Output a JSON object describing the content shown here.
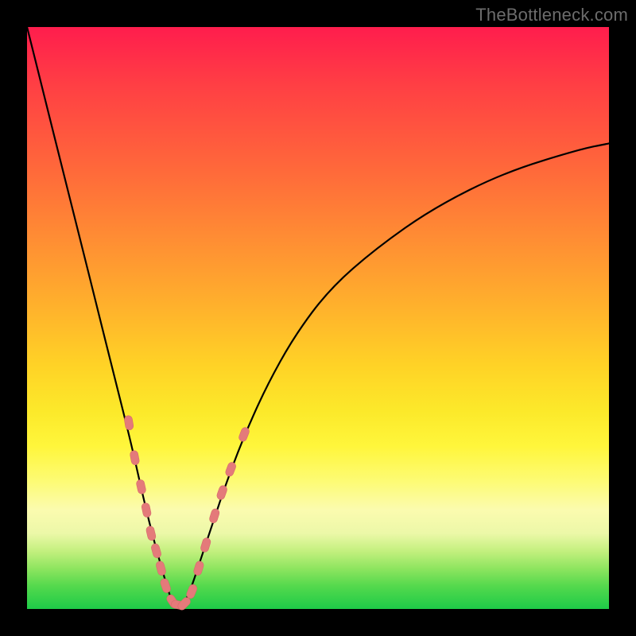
{
  "watermark": "TheBottleneck.com",
  "colors": {
    "frame": "#000000",
    "curve": "#000000",
    "marker": "#e47a7a",
    "gradient_stops": [
      "#ff1d4d",
      "#ff6a3a",
      "#ffb12c",
      "#fff63b",
      "#1ecb48"
    ]
  },
  "chart_data": {
    "type": "line",
    "title": "",
    "xlabel": "",
    "ylabel": "",
    "xlim": [
      0,
      100
    ],
    "ylim": [
      0,
      100
    ],
    "grid": false,
    "legend": false,
    "series": [
      {
        "name": "bottleneck-curve",
        "x": [
          0,
          3,
          6,
          9,
          12,
          15,
          18,
          20,
          22,
          24,
          25,
          26,
          27,
          28,
          30,
          32,
          34,
          37,
          41,
          46,
          52,
          60,
          70,
          82,
          95,
          100
        ],
        "y": [
          100,
          88,
          76,
          64,
          52,
          40,
          28,
          19,
          11,
          4,
          1,
          0,
          1,
          3,
          9,
          15,
          21,
          29,
          38,
          47,
          55,
          62,
          69,
          75,
          79,
          80
        ]
      }
    ],
    "markers": [
      {
        "x": 17.5,
        "y": 32
      },
      {
        "x": 18.5,
        "y": 26
      },
      {
        "x": 19.6,
        "y": 21
      },
      {
        "x": 20.5,
        "y": 17
      },
      {
        "x": 21.3,
        "y": 13
      },
      {
        "x": 22.2,
        "y": 10
      },
      {
        "x": 23.0,
        "y": 7
      },
      {
        "x": 23.8,
        "y": 4
      },
      {
        "x": 25.0,
        "y": 1.3
      },
      {
        "x": 26.0,
        "y": 0.7
      },
      {
        "x": 27.0,
        "y": 0.9
      },
      {
        "x": 28.3,
        "y": 3
      },
      {
        "x": 29.5,
        "y": 7
      },
      {
        "x": 30.7,
        "y": 11
      },
      {
        "x": 32.2,
        "y": 16
      },
      {
        "x": 33.5,
        "y": 20
      },
      {
        "x": 35.0,
        "y": 24
      },
      {
        "x": 37.3,
        "y": 30
      }
    ]
  }
}
